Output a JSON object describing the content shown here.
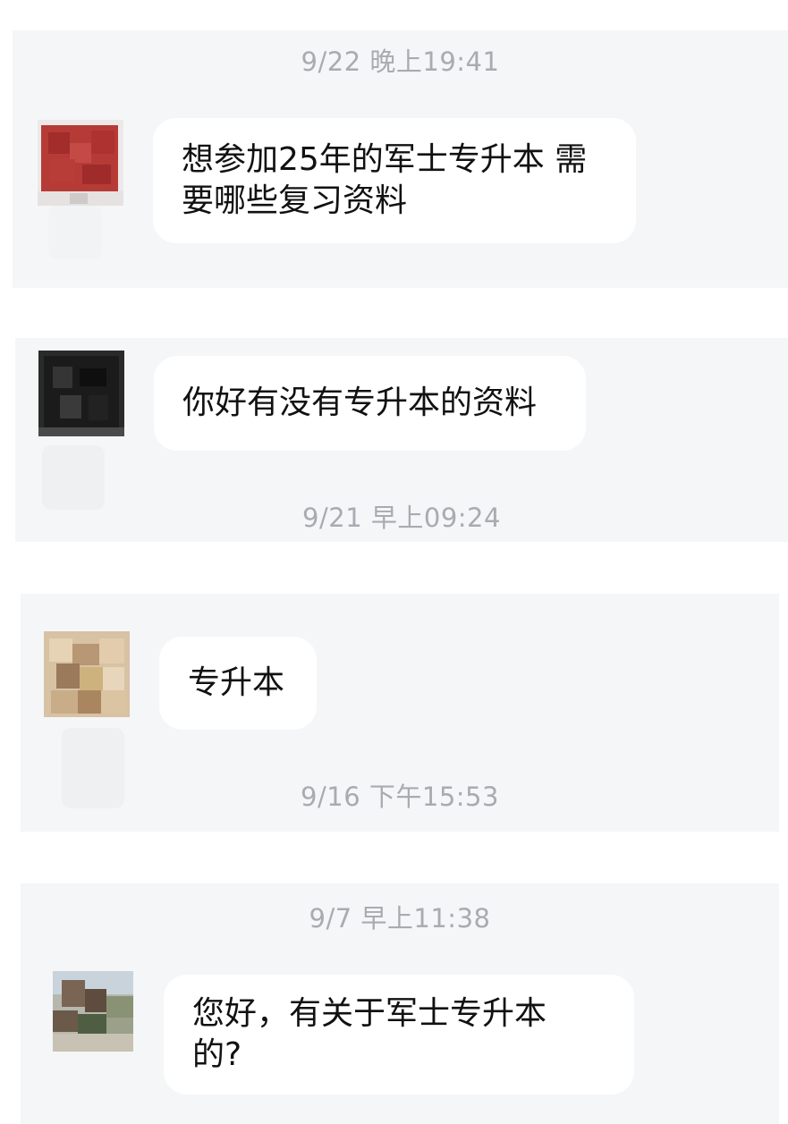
{
  "messages": [
    {
      "timestamp": "9/22 晚上19:41",
      "text": "想参加25年的军士专升本 需要哪些复习资料",
      "avatar_icon": "red-pixelated-avatar"
    },
    {
      "timestamp": "9/21 早上09:24",
      "text": "你好有没有专升本的资料",
      "avatar_icon": "dark-pixelated-avatar"
    },
    {
      "timestamp": "9/16 下午15:53",
      "text": "专升本",
      "avatar_icon": "beige-pixelated-avatar"
    },
    {
      "timestamp": "9/7 早上11:38",
      "text": "您好，有关于军士专升本的?",
      "avatar_icon": "landscape-pixelated-avatar"
    }
  ],
  "colors": {
    "panel_bg": "#f5f6f7",
    "bubble_bg": "#ffffff",
    "timestamp_text": "#a8abb0",
    "message_text": "#111111"
  }
}
